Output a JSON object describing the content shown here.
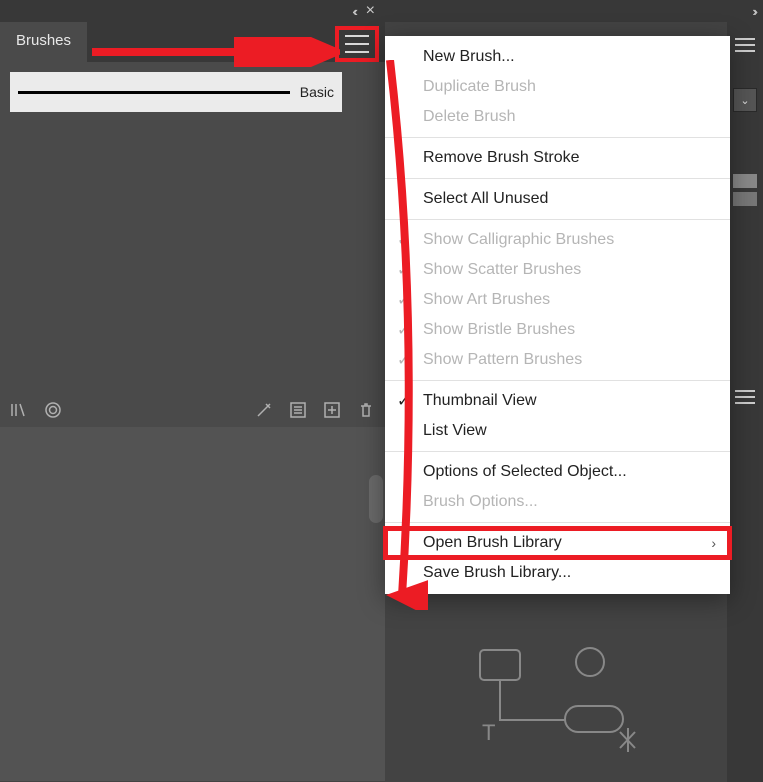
{
  "panel": {
    "tab_title": "Brushes",
    "brush_name": "Basic"
  },
  "annotations": {
    "highlight_target": "open-brush-library"
  },
  "menu": {
    "items": [
      {
        "id": "new-brush",
        "label": "New Brush...",
        "enabled": true
      },
      {
        "id": "duplicate-brush",
        "label": "Duplicate Brush",
        "enabled": false
      },
      {
        "id": "delete-brush",
        "label": "Delete Brush",
        "enabled": false
      },
      {
        "sep": true
      },
      {
        "id": "remove-brush-stroke",
        "label": "Remove Brush Stroke",
        "enabled": true
      },
      {
        "sep": true
      },
      {
        "id": "select-all-unused",
        "label": "Select All Unused",
        "enabled": true
      },
      {
        "sep": true
      },
      {
        "id": "show-calligraphic",
        "label": "Show Calligraphic Brushes",
        "enabled": false,
        "checked": true
      },
      {
        "id": "show-scatter",
        "label": "Show Scatter Brushes",
        "enabled": false,
        "checked": true
      },
      {
        "id": "show-art",
        "label": "Show Art Brushes",
        "enabled": false,
        "checked": true
      },
      {
        "id": "show-bristle",
        "label": "Show Bristle Brushes",
        "enabled": false,
        "checked": true
      },
      {
        "id": "show-pattern",
        "label": "Show Pattern Brushes",
        "enabled": false,
        "checked": true
      },
      {
        "sep": true
      },
      {
        "id": "thumbnail-view",
        "label": "Thumbnail View",
        "enabled": true,
        "checked": true
      },
      {
        "id": "list-view",
        "label": "List View",
        "enabled": true
      },
      {
        "sep": true
      },
      {
        "id": "options-selected",
        "label": "Options of Selected Object...",
        "enabled": true
      },
      {
        "id": "brush-options",
        "label": "Brush Options...",
        "enabled": false
      },
      {
        "sep": true
      },
      {
        "id": "open-brush-library",
        "label": "Open Brush Library",
        "enabled": true,
        "submenu": true,
        "highlight": true
      },
      {
        "id": "save-brush-library",
        "label": "Save Brush Library...",
        "enabled": true
      }
    ]
  }
}
